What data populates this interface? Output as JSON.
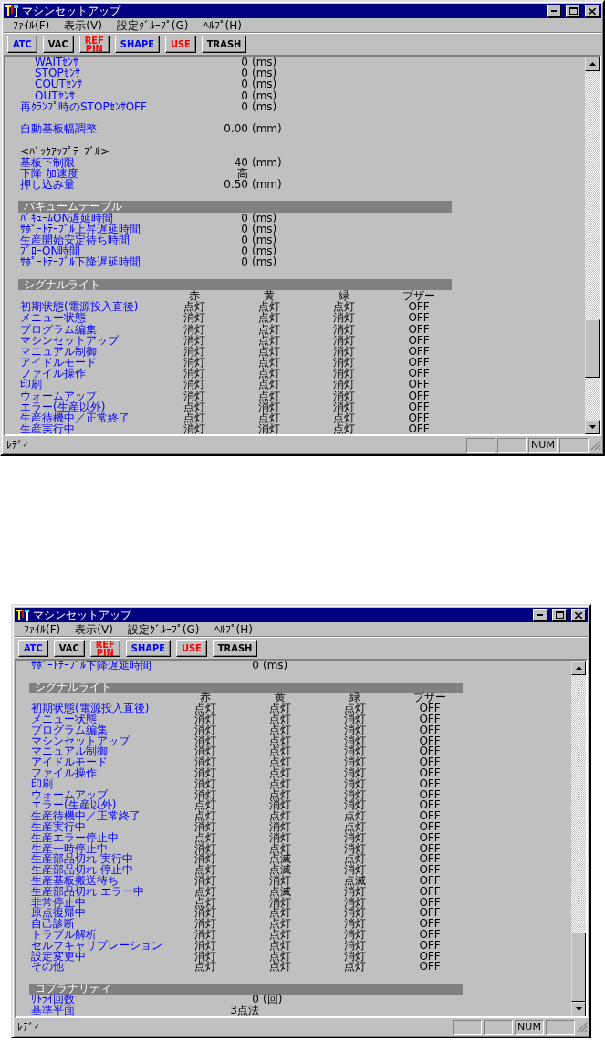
{
  "windows": [
    {
      "title": "マシンセットアップ",
      "menu": [
        "ﾌｧｲﾙ(F)",
        "表示(V)",
        "設定ｸﾞﾙｰﾌﾟ(G)",
        "ﾍﾙﾌﾟ(H)"
      ],
      "toolbar": [
        {
          "label": "ATC",
          "color": "#0000ff"
        },
        {
          "label": "VAC",
          "color": "#000000"
        },
        {
          "label": "REF\nPIN",
          "color": "#ff0000"
        },
        {
          "label": "SHAPE",
          "color": "#0000ff"
        },
        {
          "label": "USE",
          "color": "#ff0000"
        },
        {
          "label": "TRASH",
          "color": "#000000"
        }
      ],
      "content": [
        {
          "kind": "subparam",
          "label": "WAITｾﾝｻ",
          "value": "0",
          "unit": "(ms)"
        },
        {
          "kind": "subparam",
          "label": "STOPｾﾝｻ",
          "value": "0",
          "unit": "(ms)"
        },
        {
          "kind": "subparam",
          "label": "COUTｾﾝｻ",
          "value": "0",
          "unit": "(ms)"
        },
        {
          "kind": "subparam",
          "label": "OUTｾﾝｻ",
          "value": "0",
          "unit": "(ms)"
        },
        {
          "kind": "param",
          "label": "再ｸﾗﾝﾌﾟ時のSTOPｾﾝｻOFF",
          "value": "0",
          "unit": "(ms)"
        },
        {
          "kind": "blank"
        },
        {
          "kind": "param",
          "label": "自動基板幅調整",
          "value": "0.00",
          "unit": "(mm)"
        },
        {
          "kind": "blank"
        },
        {
          "kind": "note",
          "label": "<ﾊﾞｯｸｱｯﾌﾟﾃｰﾌﾞﾙ>"
        },
        {
          "kind": "param",
          "label": "基板下制限",
          "value": "40",
          "unit": "(mm)"
        },
        {
          "kind": "param",
          "label": "下降 加速度",
          "value": "高"
        },
        {
          "kind": "param",
          "label": "押し込み量",
          "value": "0.50",
          "unit": "(mm)"
        },
        {
          "kind": "blank"
        },
        {
          "kind": "section",
          "label": "バキュームテーブル"
        },
        {
          "kind": "param",
          "label": "ﾊﾞｷｭｰﾑON遅延時間",
          "value": "0",
          "unit": "(ms)"
        },
        {
          "kind": "param",
          "label": "ｻﾎﾟｰﾄﾃｰﾌﾞﾙ上昇遅延時間",
          "value": "0",
          "unit": "(ms)"
        },
        {
          "kind": "param",
          "label": "生産開始安定待ち時間",
          "value": "0",
          "unit": "(ms)"
        },
        {
          "kind": "param",
          "label": "ﾌﾞﾛｰON時間",
          "value": "0",
          "unit": "(ms)"
        },
        {
          "kind": "param",
          "label": "ｻﾎﾟｰﾄﾃｰﾌﾞﾙ下降遅延時間",
          "value": "0",
          "unit": "(ms)"
        },
        {
          "kind": "blank"
        },
        {
          "kind": "section",
          "label": "シグナルライト"
        },
        {
          "kind": "columns",
          "labels": [
            "赤",
            "黄",
            "緑",
            "ブザー"
          ]
        },
        {
          "kind": "signal",
          "label": "初期状態(電源投入直後)",
          "cells": [
            "点灯",
            "点灯",
            "点灯",
            "OFF"
          ]
        },
        {
          "kind": "signal",
          "label": "メニュー状態",
          "cells": [
            "消灯",
            "点灯",
            "消灯",
            "OFF"
          ]
        },
        {
          "kind": "signal",
          "label": "プログラム編集",
          "cells": [
            "消灯",
            "点灯",
            "消灯",
            "OFF"
          ]
        },
        {
          "kind": "signal",
          "label": "マシンセットアップ",
          "cells": [
            "消灯",
            "点灯",
            "消灯",
            "OFF"
          ]
        },
        {
          "kind": "signal",
          "label": "マニュアル制御",
          "cells": [
            "消灯",
            "点灯",
            "消灯",
            "OFF"
          ]
        },
        {
          "kind": "signal",
          "label": "アイドルモード",
          "cells": [
            "消灯",
            "点灯",
            "消灯",
            "OFF"
          ]
        },
        {
          "kind": "signal",
          "label": "ファイル操作",
          "cells": [
            "消灯",
            "点灯",
            "消灯",
            "OFF"
          ]
        },
        {
          "kind": "signal",
          "label": "印刷",
          "cells": [
            "消灯",
            "点灯",
            "消灯",
            "OFF"
          ]
        },
        {
          "kind": "signal",
          "label": "ウォームアップ",
          "cells": [
            "消灯",
            "点灯",
            "消灯",
            "OFF"
          ]
        },
        {
          "kind": "signal",
          "label": "エラー(生産以外)",
          "cells": [
            "点灯",
            "消灯",
            "消灯",
            "OFF"
          ]
        },
        {
          "kind": "signal",
          "label": "生産待機中／正常終了",
          "cells": [
            "点灯",
            "点灯",
            "点灯",
            "OFF"
          ]
        },
        {
          "kind": "signal",
          "label": "生産実行中",
          "cells": [
            "消灯",
            "消灯",
            "点灯",
            "OFF"
          ]
        }
      ],
      "status_bar": {
        "message": "ﾚﾃﾞｨ",
        "indicators": [
          "NUM"
        ]
      }
    },
    {
      "title": "マシンセットアップ",
      "menu": [
        "ﾌｧｲﾙ(F)",
        "表示(V)",
        "設定ｸﾞﾙｰﾌﾟ(G)",
        "ﾍﾙﾌﾟ(H)"
      ],
      "toolbar": [
        {
          "label": "ATC",
          "color": "#0000ff"
        },
        {
          "label": "VAC",
          "color": "#000000"
        },
        {
          "label": "REF\nPIN",
          "color": "#ff0000"
        },
        {
          "label": "SHAPE",
          "color": "#0000ff"
        },
        {
          "label": "USE",
          "color": "#ff0000"
        },
        {
          "label": "TRASH",
          "color": "#000000"
        }
      ],
      "content": [
        {
          "kind": "param",
          "label": "ｻﾎﾟｰﾄﾃｰﾌﾞﾙ下降遅延時間",
          "value": "0",
          "unit": "(ms)"
        },
        {
          "kind": "blank"
        },
        {
          "kind": "section",
          "label": "シグナルライト"
        },
        {
          "kind": "columns",
          "labels": [
            "赤",
            "黄",
            "緑",
            "ブザー"
          ]
        },
        {
          "kind": "signal",
          "label": "初期状態(電源投入直後)",
          "cells": [
            "点灯",
            "点灯",
            "点灯",
            "OFF"
          ]
        },
        {
          "kind": "signal",
          "label": "メニュー状態",
          "cells": [
            "消灯",
            "点灯",
            "消灯",
            "OFF"
          ]
        },
        {
          "kind": "signal",
          "label": "プログラム編集",
          "cells": [
            "消灯",
            "点灯",
            "消灯",
            "OFF"
          ]
        },
        {
          "kind": "signal",
          "label": "マシンセットアップ",
          "cells": [
            "消灯",
            "点灯",
            "消灯",
            "OFF"
          ]
        },
        {
          "kind": "signal",
          "label": "マニュアル制御",
          "cells": [
            "消灯",
            "点灯",
            "消灯",
            "OFF"
          ]
        },
        {
          "kind": "signal",
          "label": "アイドルモード",
          "cells": [
            "消灯",
            "点灯",
            "消灯",
            "OFF"
          ]
        },
        {
          "kind": "signal",
          "label": "ファイル操作",
          "cells": [
            "消灯",
            "点灯",
            "消灯",
            "OFF"
          ]
        },
        {
          "kind": "signal",
          "label": "印刷",
          "cells": [
            "消灯",
            "点灯",
            "消灯",
            "OFF"
          ]
        },
        {
          "kind": "signal",
          "label": "ウォームアップ",
          "cells": [
            "消灯",
            "点灯",
            "消灯",
            "OFF"
          ]
        },
        {
          "kind": "signal",
          "label": "エラー(生産以外)",
          "cells": [
            "点灯",
            "消灯",
            "消灯",
            "OFF"
          ]
        },
        {
          "kind": "signal",
          "label": "生産待機中／正常終了",
          "cells": [
            "点灯",
            "点灯",
            "点灯",
            "OFF"
          ]
        },
        {
          "kind": "signal",
          "label": "生産実行中",
          "cells": [
            "消灯",
            "消灯",
            "点灯",
            "OFF"
          ]
        },
        {
          "kind": "signal",
          "label": "生産エラー停止中",
          "cells": [
            "点灯",
            "消灯",
            "消灯",
            "OFF"
          ]
        },
        {
          "kind": "signal",
          "label": "生産一時停止中",
          "cells": [
            "消灯",
            "点灯",
            "消灯",
            "OFF"
          ]
        },
        {
          "kind": "signal",
          "label": "生産部品切れ 実行中",
          "cells": [
            "消灯",
            "点滅",
            "点灯",
            "OFF"
          ]
        },
        {
          "kind": "signal",
          "label": "生産部品切れ 停止中",
          "cells": [
            "点灯",
            "点滅",
            "消灯",
            "OFF"
          ]
        },
        {
          "kind": "signal",
          "label": "生産基板搬送待ち",
          "cells": [
            "消灯",
            "消灯",
            "点滅",
            "OFF"
          ]
        },
        {
          "kind": "signal",
          "label": "生産部品切れ エラー中",
          "cells": [
            "点灯",
            "点滅",
            "消灯",
            "OFF"
          ]
        },
        {
          "kind": "signal",
          "label": "非常停止中",
          "cells": [
            "点灯",
            "消灯",
            "消灯",
            "OFF"
          ]
        },
        {
          "kind": "signal",
          "label": "原点復帰中",
          "cells": [
            "消灯",
            "点灯",
            "消灯",
            "OFF"
          ]
        },
        {
          "kind": "signal",
          "label": "自己診断",
          "cells": [
            "消灯",
            "点灯",
            "消灯",
            "OFF"
          ]
        },
        {
          "kind": "signal",
          "label": "トラブル解析",
          "cells": [
            "消灯",
            "点灯",
            "消灯",
            "OFF"
          ]
        },
        {
          "kind": "signal",
          "label": "セルフキャリブレーション",
          "cells": [
            "消灯",
            "点灯",
            "消灯",
            "OFF"
          ]
        },
        {
          "kind": "signal",
          "label": "設定変更中",
          "cells": [
            "消灯",
            "点灯",
            "消灯",
            "OFF"
          ]
        },
        {
          "kind": "signal",
          "label": "その他",
          "cells": [
            "点灯",
            "点灯",
            "点灯",
            "OFF"
          ]
        },
        {
          "kind": "blank"
        },
        {
          "kind": "section",
          "label": "コプラナリティ"
        },
        {
          "kind": "param",
          "label": "ﾘﾄﾗｲ回数",
          "value": "0",
          "unit": "(回)"
        },
        {
          "kind": "param",
          "label": "基準平面",
          "value": "3点法"
        }
      ],
      "status_bar": {
        "message": "ﾚﾃﾞｨ",
        "indicators": [
          "NUM"
        ]
      }
    }
  ]
}
